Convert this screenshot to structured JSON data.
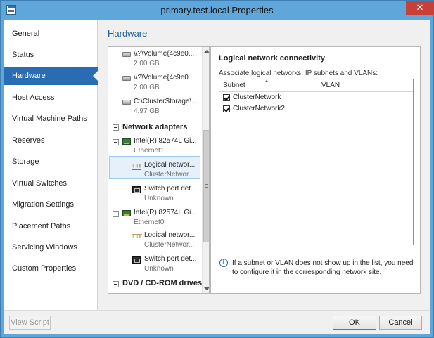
{
  "window": {
    "title": "primary.test.local Properties",
    "close_glyph": "✕"
  },
  "nav": {
    "items": [
      {
        "label": "General"
      },
      {
        "label": "Status"
      },
      {
        "label": "Hardware",
        "selected": true
      },
      {
        "label": "Host Access"
      },
      {
        "label": "Virtual Machine Paths"
      },
      {
        "label": "Reserves"
      },
      {
        "label": "Storage"
      },
      {
        "label": "Virtual Switches"
      },
      {
        "label": "Migration Settings"
      },
      {
        "label": "Placement Paths"
      },
      {
        "label": "Servicing Windows"
      },
      {
        "label": "Custom Properties"
      }
    ]
  },
  "section_title": "Hardware",
  "tree": {
    "volumes": [
      {
        "name": "\\\\?\\Volume{4c9e0...",
        "size": "2.00 GB"
      },
      {
        "name": "\\\\?\\Volume{4c9e0...",
        "size": "2.00 GB"
      },
      {
        "name": "C:\\ClusterStorage\\...",
        "size": "4.97 GB"
      }
    ],
    "network_adapters_header": "Network adapters",
    "adapters": [
      {
        "name": "Intel(R) 82574L Gi...",
        "sub": "Ethernet1"
      },
      {
        "name": "Intel(R) 82574L Gi...",
        "sub": "Ethernet0"
      }
    ],
    "children": [
      {
        "name": "Logical networ...",
        "sub": "ClusterNetwor...",
        "selected": true
      },
      {
        "name": "Switch port det...",
        "sub": "Unknown"
      },
      {
        "name": "Logical networ...",
        "sub": "ClusterNetwor..."
      },
      {
        "name": "Switch port det...",
        "sub": "Unknown"
      }
    ],
    "dvd_header": "DVD / CD-ROM drives"
  },
  "detail": {
    "title": "Logical network connectivity",
    "description": "Associate logical networks, IP subnets and VLANs:",
    "columns": {
      "subnet": "Subnet",
      "vlan": "VLAN"
    },
    "rows": [
      {
        "label": "ClusterNetwork",
        "checked": true
      },
      {
        "label": "ClusterNetwork2",
        "checked": true
      }
    ],
    "info_glyph": "i",
    "info_text": "If a subnet or VLAN does not show up in the list, you need to configure it in the corresponding network site."
  },
  "buttons": {
    "view_script": "View Script",
    "ok": "OK",
    "cancel": "Cancel"
  }
}
